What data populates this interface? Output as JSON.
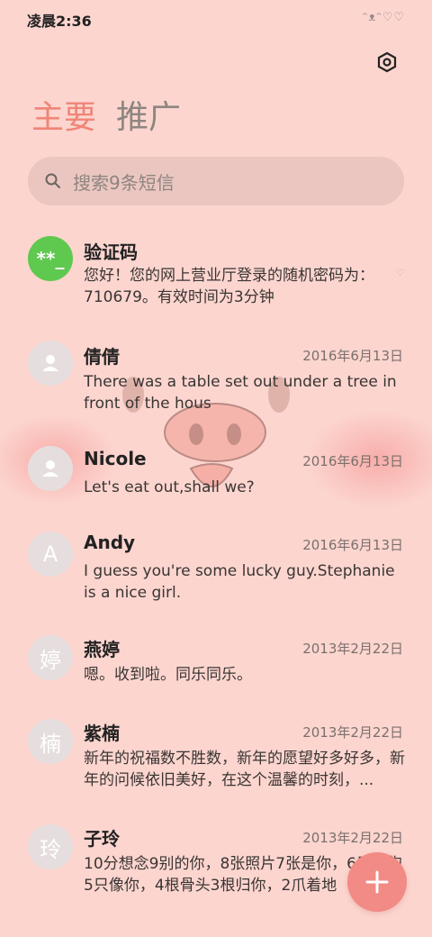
{
  "status": {
    "time": "凌晨2:36",
    "icons": "ᵔᴥᵔ♡♡"
  },
  "tabs": [
    {
      "label": "主要"
    },
    {
      "label": "推广"
    }
  ],
  "search": {
    "placeholder": "搜索9条短信"
  },
  "conversations": [
    {
      "avatar_text": "**_",
      "name": "验证码",
      "date": "",
      "preview": "您好！您的网上营业厅登录的随机密码为：710679。有效时间为3分钟",
      "marker": "♡"
    },
    {
      "avatar_text": "",
      "name": "倩倩",
      "date": "2016年6月13日",
      "preview": "There was a table set out under a tree in front of the hous"
    },
    {
      "avatar_text": "",
      "name": "Nicole",
      "date": "2016年6月13日",
      "preview": "Let's eat out,shall we?"
    },
    {
      "avatar_text": "A",
      "name": "Andy",
      "date": "2016年6月13日",
      "preview": "I guess you're some lucky guy.Stephanie is a nice girl."
    },
    {
      "avatar_text": "婷",
      "name": "燕婷",
      "date": "2013年2月22日",
      "preview": "嗯。收到啦。同乐同乐。"
    },
    {
      "avatar_text": "楠",
      "name": "紫楠",
      "date": "2013年2月22日",
      "preview": "新年的祝福数不胜数，新年的愿望好多好多，新年的问候依旧美好，在这个温馨的时刻，..."
    },
    {
      "avatar_text": "玲",
      "name": "子玲",
      "date": "2013年2月22日",
      "preview": "10分想念9别的你，8张照片7张是你，6只小狗5只像你，4根骨头3根归你，2爪着地"
    }
  ],
  "colors": {
    "background": "#fcd5cf",
    "accent": "#f08577",
    "fab": "#f28a85",
    "otp_avatar": "#5fc84f"
  }
}
